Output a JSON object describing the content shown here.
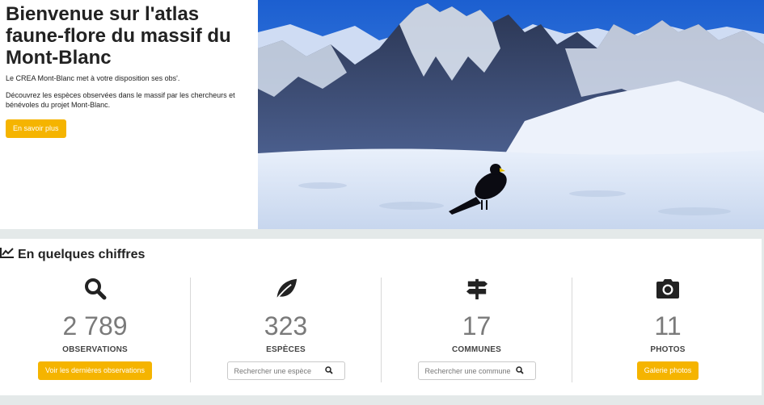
{
  "hero": {
    "title": "Bienvenue sur l'atlas faune-flore du massif du Mont-Blanc",
    "intro": "Le CREA Mont-Blanc met à votre disposition ses obs'.",
    "description": "Découvrez les espèces observées dans le massif par les chercheurs et bénévoles du projet Mont-Blanc.",
    "button_label": "En savoir plus",
    "image": "alpine-chough-on-snow-with-mountain-peaks"
  },
  "stats": {
    "title": "En quelques chiffres",
    "title_icon": "line-chart-icon",
    "items": [
      {
        "icon": "search-icon",
        "value": "2 789",
        "label": "OBSERVATIONS",
        "action_type": "button",
        "action_label": "Voir les dernières observations"
      },
      {
        "icon": "leaf-icon",
        "value": "323",
        "label": "ESPÈCES",
        "action_type": "search",
        "placeholder": "Rechercher une espèce"
      },
      {
        "icon": "signpost-icon",
        "value": "17",
        "label": "COMMUNES",
        "action_type": "search",
        "placeholder": "Rechercher une commune"
      },
      {
        "icon": "camera-icon",
        "value": "11",
        "label": "PHOTOS",
        "action_type": "button",
        "action_label": "Galerie photos"
      }
    ]
  },
  "colors": {
    "accent": "#f5b400",
    "number": "#7a7a7a",
    "background": "#e4e9e9"
  }
}
